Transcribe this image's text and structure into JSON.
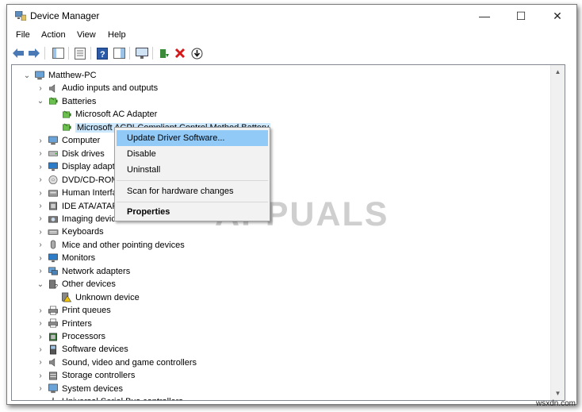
{
  "window": {
    "title": "Device Manager",
    "minimize": "—",
    "maximize": "☐",
    "close": "✕"
  },
  "menu": [
    "File",
    "Action",
    "View",
    "Help"
  ],
  "tree": {
    "root": "Matthew-PC",
    "items": [
      {
        "label": "Audio inputs and outputs",
        "expanded": false,
        "icon": "speaker-icon"
      },
      {
        "label": "Batteries",
        "expanded": true,
        "icon": "battery-icon"
      },
      {
        "label": "Microsoft AC Adapter",
        "child": true,
        "icon": "battery-icon"
      },
      {
        "label": "Microsoft ACPI-Compliant Control Method Battery",
        "child": true,
        "selected": true,
        "icon": "battery-icon"
      },
      {
        "label": "Computer",
        "expanded": false,
        "icon": "computer-icon"
      },
      {
        "label": "Disk drives",
        "expanded": false,
        "icon": "disk-icon"
      },
      {
        "label": "Display adapters",
        "expanded": false,
        "icon": "monitor-icon"
      },
      {
        "label": "DVD/CD-ROM drives",
        "expanded": false,
        "icon": "dvd-icon"
      },
      {
        "label": "Human Interface Devices",
        "expanded": false,
        "icon": "hid-icon"
      },
      {
        "label": "IDE ATA/ATAPI controllers",
        "expanded": false,
        "icon": "ide-icon"
      },
      {
        "label": "Imaging devices",
        "expanded": false,
        "icon": "camera-icon"
      },
      {
        "label": "Keyboards",
        "expanded": false,
        "icon": "keyboard-icon"
      },
      {
        "label": "Mice and other pointing devices",
        "expanded": false,
        "icon": "mouse-icon"
      },
      {
        "label": "Monitors",
        "expanded": false,
        "icon": "monitor-icon"
      },
      {
        "label": "Network adapters",
        "expanded": false,
        "icon": "network-icon"
      },
      {
        "label": "Other devices",
        "expanded": true,
        "icon": "other-device-icon"
      },
      {
        "label": "Unknown device",
        "child": true,
        "icon": "warning-icon"
      },
      {
        "label": "Print queues",
        "expanded": false,
        "icon": "printer-icon"
      },
      {
        "label": "Printers",
        "expanded": false,
        "icon": "printer-icon"
      },
      {
        "label": "Processors",
        "expanded": false,
        "icon": "cpu-icon"
      },
      {
        "label": "Software devices",
        "expanded": false,
        "icon": "software-icon"
      },
      {
        "label": "Sound, video and game controllers",
        "expanded": false,
        "icon": "speaker-icon"
      },
      {
        "label": "Storage controllers",
        "expanded": false,
        "icon": "storage-icon"
      },
      {
        "label": "System devices",
        "expanded": false,
        "icon": "system-icon"
      },
      {
        "label": "Universal Serial Bus controllers",
        "expanded": false,
        "icon": "usb-icon"
      }
    ]
  },
  "context_menu": {
    "update": "Update Driver Software...",
    "disable": "Disable",
    "uninstall": "Uninstall",
    "scan": "Scan for hardware changes",
    "properties": "Properties"
  },
  "watermark": "APPUALS",
  "credit": "wsxdn.com",
  "colors": {
    "highlight": "#91c9f7",
    "selection": "#cce8ff",
    "arrow": "#e8141b"
  }
}
